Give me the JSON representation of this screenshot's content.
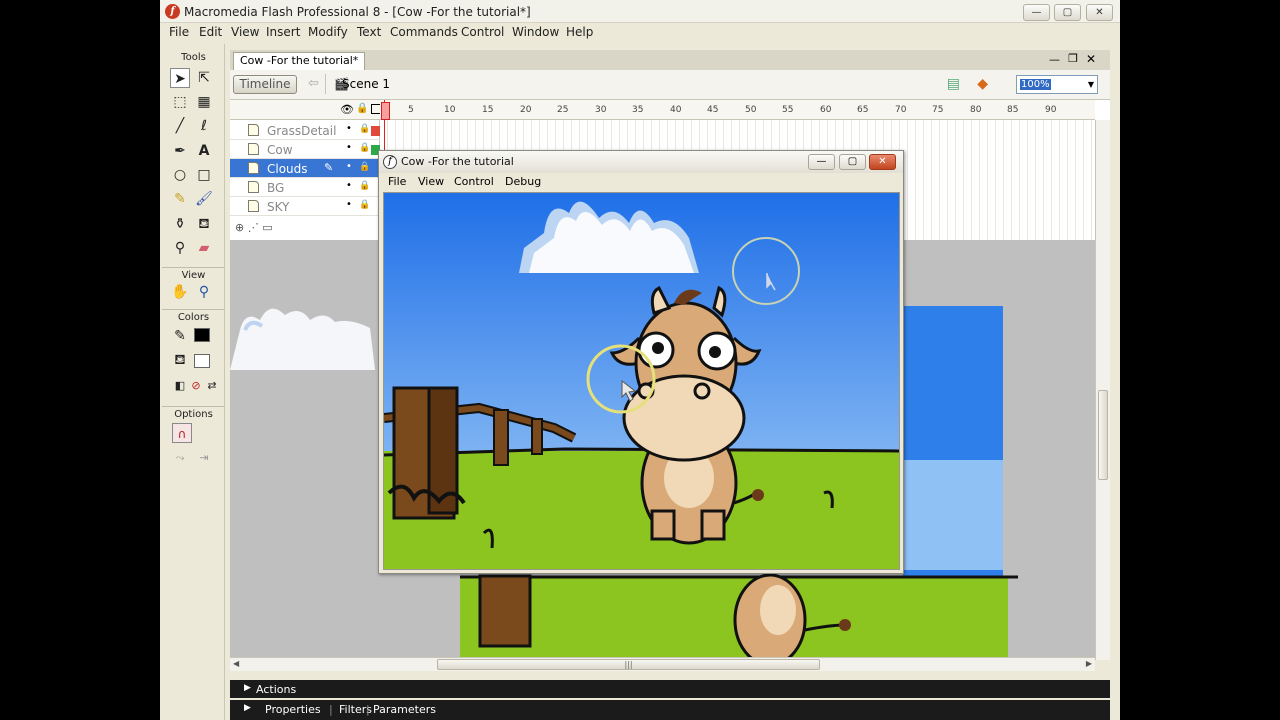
{
  "window": {
    "title": "Macromedia Flash Professional 8 - [Cow -For the tutorial*]",
    "app_icon_glyph": "f",
    "min_glyph": "—",
    "max_glyph": "▢",
    "close_glyph": "✕"
  },
  "menu": [
    "File",
    "Edit",
    "View",
    "Insert",
    "Modify",
    "Text",
    "Commands",
    "Control",
    "Window",
    "Help"
  ],
  "tools": {
    "header": "Tools",
    "view_header": "View",
    "colors_header": "Colors",
    "options_header": "Options"
  },
  "document": {
    "tab_label": "Cow -For the tutorial*",
    "timeline_button": "Timeline",
    "scene_label": "Scene 1",
    "zoom_value": "100%"
  },
  "timeline": {
    "frame_numbers": [
      "5",
      "10",
      "15",
      "20",
      "25",
      "30",
      "35",
      "40",
      "45",
      "50",
      "55",
      "60",
      "65",
      "70",
      "75",
      "80",
      "85",
      "90"
    ],
    "layers": [
      {
        "name": "GrassDetail",
        "selected": false
      },
      {
        "name": "Cow",
        "selected": false
      },
      {
        "name": "Clouds",
        "selected": true
      },
      {
        "name": "BG",
        "selected": false
      },
      {
        "name": "SKY",
        "selected": false
      }
    ]
  },
  "player": {
    "title": "Cow -For the tutorial",
    "menu": [
      "File",
      "View",
      "Control",
      "Debug"
    ],
    "icon_glyph": "f"
  },
  "panels": {
    "actions": "Actions",
    "properties": "Properties",
    "filters": "Filters",
    "parameters": "Parameters"
  },
  "colors": {
    "sky_top": "#1f6fe8",
    "sky_bottom": "#a9d2f7",
    "grass": "#8cc51f",
    "selection": "#3975d3",
    "layer_red": "#e04a3a",
    "layer_green": "#2fa84a"
  }
}
